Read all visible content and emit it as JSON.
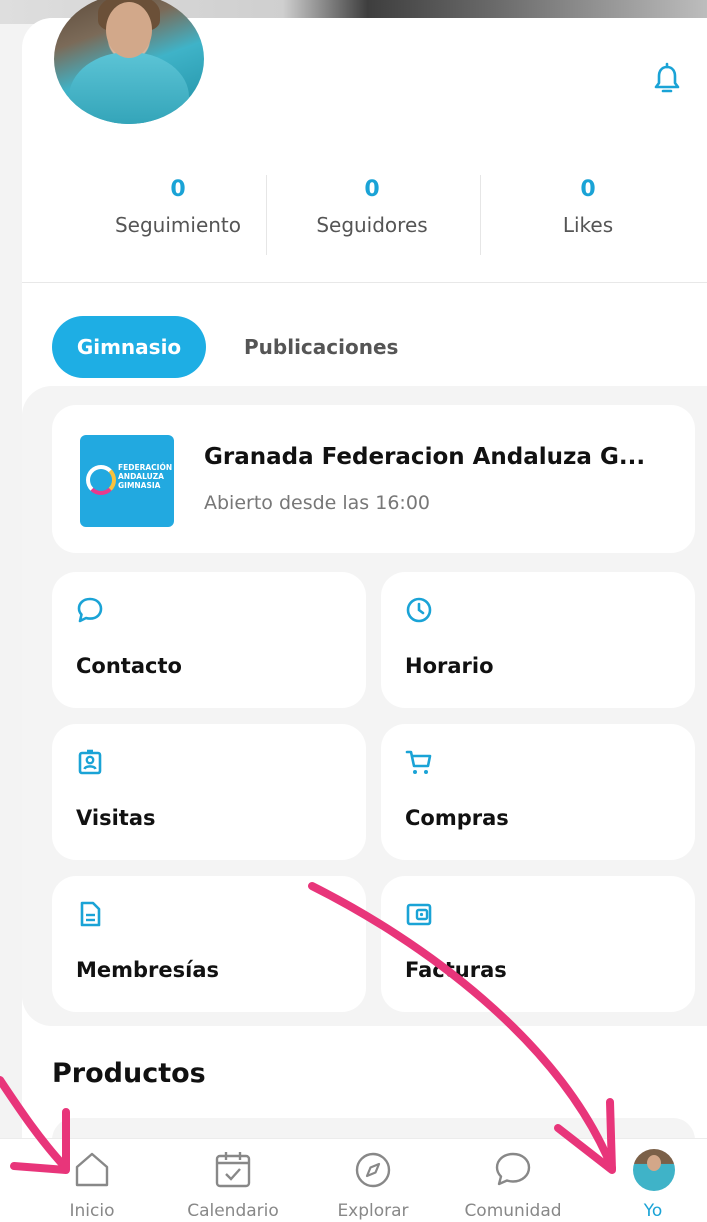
{
  "profile": {
    "notifications_icon": "bell-icon",
    "stats": [
      {
        "value": "0",
        "label": "Seguimiento"
      },
      {
        "value": "0",
        "label": "Seguidores"
      },
      {
        "value": "0",
        "label": "Likes"
      }
    ]
  },
  "tabs": [
    {
      "label": "Gimnasio",
      "active": true
    },
    {
      "label": "Publicaciones",
      "active": false
    }
  ],
  "gym": {
    "name": "Granada Federacion Andaluza G...",
    "status": "Abierto desde las 16:00",
    "logo_lines": [
      "FEDERACIÓN",
      "ANDALUZA",
      "GIMNASIA"
    ]
  },
  "tiles": [
    {
      "label": "Contacto",
      "icon": "chat-bubble-icon"
    },
    {
      "label": "Horario",
      "icon": "clock-icon"
    },
    {
      "label": "Visitas",
      "icon": "badge-icon"
    },
    {
      "label": "Compras",
      "icon": "cart-icon"
    },
    {
      "label": "Membresías",
      "icon": "document-icon"
    },
    {
      "label": "Facturas",
      "icon": "wallet-icon"
    }
  ],
  "products": {
    "title": "Productos"
  },
  "bottom_nav": [
    {
      "label": "Inicio",
      "icon": "home-icon"
    },
    {
      "label": "Calendario",
      "icon": "calendar-icon"
    },
    {
      "label": "Explorar",
      "icon": "compass-icon"
    },
    {
      "label": "Comunidad",
      "icon": "chat-icon"
    },
    {
      "label": "Yo",
      "icon": "avatar",
      "active": true
    }
  ],
  "colors": {
    "accent": "#1eaee4",
    "annotation_arrow": "#e8357a"
  }
}
